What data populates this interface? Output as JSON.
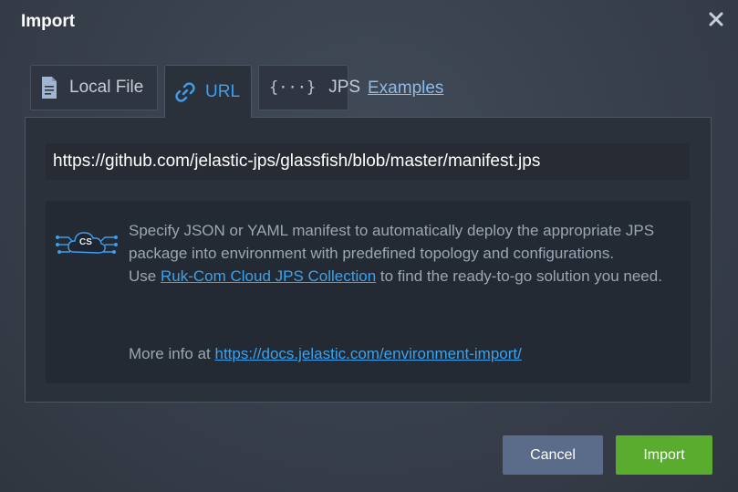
{
  "dialog": {
    "title": "Import"
  },
  "tabs": {
    "local_file": "Local File",
    "url": "URL",
    "jps": "JPS",
    "jps_icon_text": "{···}",
    "examples": "Examples"
  },
  "url_input": {
    "value": "https://github.com/jelastic-jps/glassfish/blob/master/manifest.jps"
  },
  "info": {
    "icon_text": "CS",
    "line1": "Specify JSON or YAML manifest to automatically deploy the appropriate JPS package into environment with predefined topology and configurations.",
    "use_prefix": "Use ",
    "collection_link": "Ruk-Com Cloud JPS Collection",
    "use_suffix": " to find the ready-to-go solution you need.",
    "more_prefix": "More info at ",
    "more_link": "https://docs.jelastic.com/environment-import/"
  },
  "buttons": {
    "cancel": "Cancel",
    "import": "Import"
  },
  "colors": {
    "accent_blue": "#3b9ff0",
    "import_green": "#5aac2e",
    "cancel_slate": "#5b6c8a"
  },
  "icons": {
    "close": "close-icon",
    "local_file": "document-icon",
    "url": "link-icon",
    "jps": "braces-icon",
    "info": "cloud-network-icon"
  }
}
